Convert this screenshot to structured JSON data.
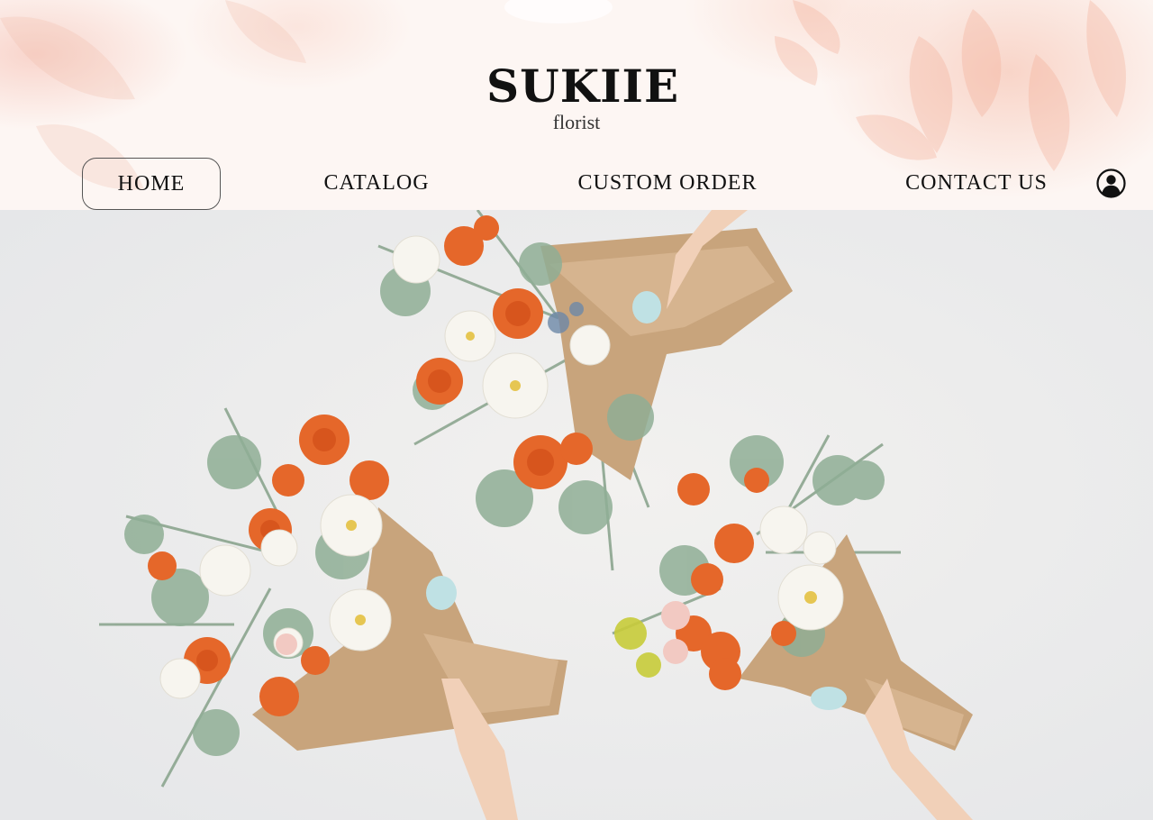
{
  "brand": {
    "name": "SUKIIE",
    "tagline": "florist"
  },
  "nav": {
    "items": [
      {
        "label": "HOME",
        "active": true
      },
      {
        "label": "CATALOG",
        "active": false
      },
      {
        "label": "CUSTOM ORDER",
        "active": false
      },
      {
        "label": "CONTACT US",
        "active": false
      }
    ],
    "account_icon": "user-circle-icon"
  },
  "hero": {
    "image": "three-flower-bouquets-photo",
    "colors": {
      "background": "#eeeeee",
      "flower_orange": "#e5672a",
      "flower_white": "#f6f4ef",
      "paper": "#c9a57e",
      "greenery": "#8aa58e"
    }
  },
  "colors": {
    "text": "#111111",
    "header_accent": "#f0a58c"
  }
}
